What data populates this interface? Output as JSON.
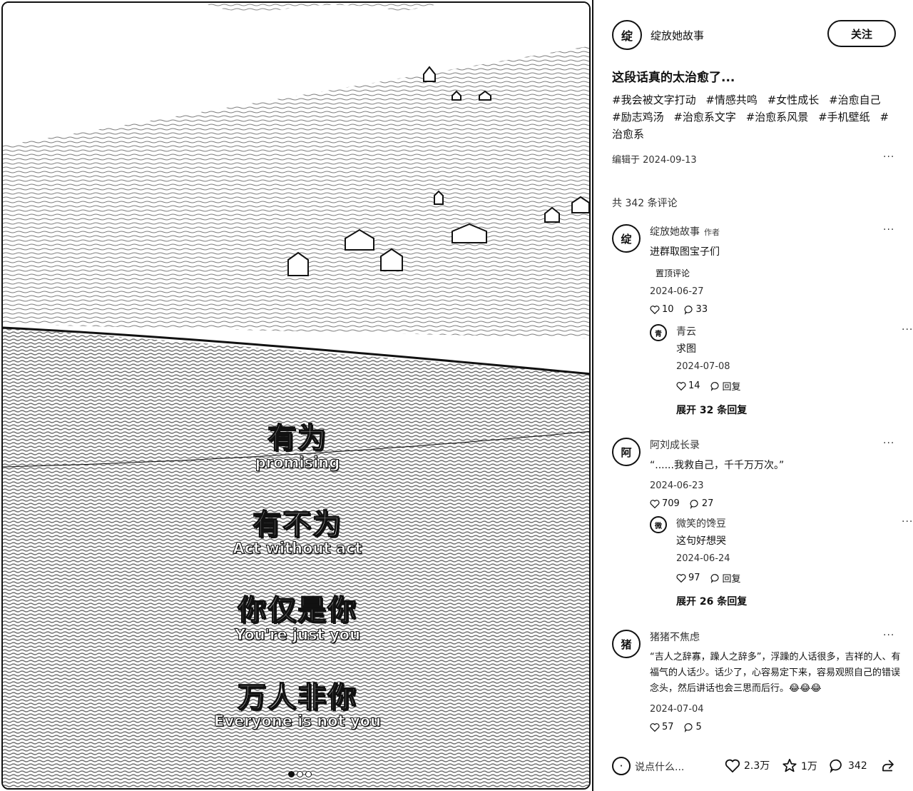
{
  "media": {
    "captions": [
      {
        "cn": "有为",
        "en": "promising"
      },
      {
        "cn": "有不为",
        "en": "Act without act"
      },
      {
        "cn": "你仅是你",
        "en": "You're just you"
      },
      {
        "cn": "万人非你",
        "en": "Everyone is not you"
      }
    ],
    "page_dots": 3,
    "active_dot": 1
  },
  "author": {
    "name": "绽放她故事",
    "avatar_glyph": "绽",
    "follow_label": "关注"
  },
  "post": {
    "title": "这段话真的太治愈了...",
    "tags": [
      "#我会被文字打动",
      "#情感共鸣",
      "#女性成长",
      "#治愈自己",
      "#励志鸡汤",
      "#治愈系文字",
      "#治愈系风景",
      "#手机壁纸",
      "#治愈系"
    ],
    "edited": "编辑于 2024-09-13",
    "more": "···"
  },
  "comments_header": "共 342 条评论",
  "comments": [
    {
      "name": "绽放她故事",
      "tag": "作者",
      "avatar": "绽",
      "text": "进群取图宝子们",
      "pin": "置顶评论",
      "date": "2024-06-27",
      "likes": "10",
      "replies": "33",
      "reply": {
        "name": "青云",
        "avatar": "青",
        "text": "求图",
        "date": "2024-07-08",
        "likes": "14",
        "reply_label": "回复"
      },
      "expand": "展开 32 条回复"
    },
    {
      "name": "阿刘成长录",
      "avatar": "阿",
      "text": "“......我救自己，千千万万次。”",
      "date": "2024-06-23",
      "likes": "709",
      "replies": "27",
      "reply": {
        "name": "微笑的馋豆",
        "avatar": "微",
        "text": "这句好想哭",
        "date": "2024-06-24",
        "likes": "97",
        "reply_label": "回复"
      },
      "expand": "展开 26 条回复"
    },
    {
      "name": "猪猪不焦虑",
      "avatar": "猪",
      "text": "“吉人之辞寡，躁人之辞多”，浮躁的人话很多，吉祥的人、有福气的人话少。话少了，心容易定下来，容易观照自己的错误念头，然后讲话也会三思而后行。😂😂😂",
      "date": "2024-07-04",
      "likes": "57",
      "replies": "5"
    }
  ],
  "bottom_bar": {
    "placeholder": "说点什么...",
    "likes": "2.3万",
    "stars": "1万",
    "comments": "342"
  },
  "icons": [
    "heart-icon",
    "comment-icon",
    "star-icon",
    "share-icon",
    "more-icon"
  ]
}
